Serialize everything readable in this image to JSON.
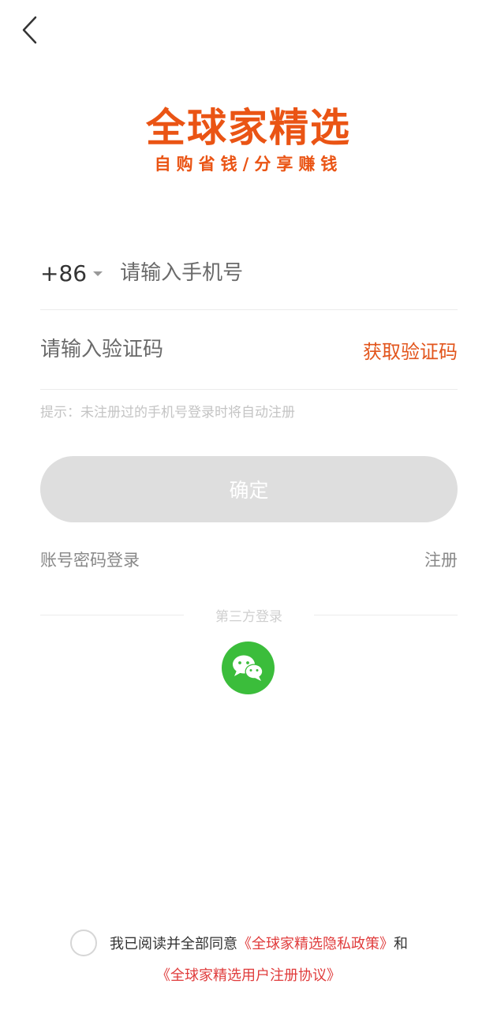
{
  "header": {
    "back_icon": "chevron-left-icon"
  },
  "logo": {
    "title": "全球家精选",
    "slogan": "自购省钱/分享赚钱",
    "color": "#ea5414"
  },
  "form": {
    "country_code": "+86",
    "phone_placeholder": "请输入手机号",
    "code_placeholder": "请输入验证码",
    "get_code_label": "获取验证码",
    "hint": "提示：未注册过的手机号登录时将自动注册",
    "confirm_label": "确定"
  },
  "links": {
    "password_login": "账号密码登录",
    "register": "注册"
  },
  "third_party": {
    "label": "第三方登录",
    "wechat_icon": "wechat-icon",
    "wechat_color": "#3bbd3b"
  },
  "agreement": {
    "prefix": "我已阅读并全部同意",
    "privacy_policy": "《全球家精选隐私政策》",
    "connector": "和",
    "user_agreement": "《全球家精选用户注册协议》",
    "link_color": "#e03c3c"
  }
}
